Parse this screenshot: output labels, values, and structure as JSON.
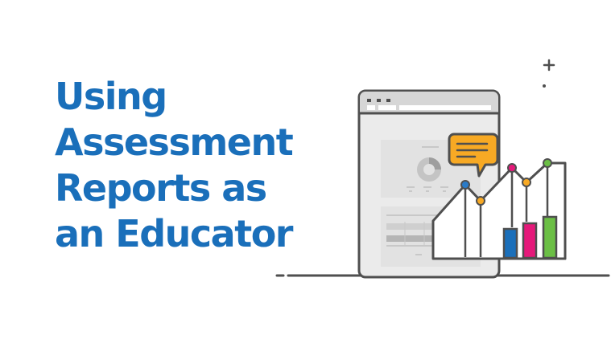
{
  "title": {
    "lines": [
      "Using",
      "Assessment",
      "Reports as",
      "an Educator"
    ]
  },
  "illustration": {
    "icons": [
      "browser-window-icon",
      "donut-chart-icon",
      "speech-bubble-icon",
      "line-chart-icon",
      "bar-chart-icon",
      "sparkle-icon"
    ]
  },
  "colors": {
    "title": "#1a6fba",
    "outline": "#4f4f4f",
    "bubble": "#f7a924",
    "bar_blue": "#1a6fba",
    "bar_pink": "#e5197a",
    "bar_green": "#6bbf45",
    "point_blue": "#2a7bc8",
    "point_orange": "#f7a924",
    "point_pink": "#e5197a",
    "point_green": "#6bbf45",
    "window_fill": "#ebebeb",
    "panel_fill": "#e2e2e2"
  }
}
